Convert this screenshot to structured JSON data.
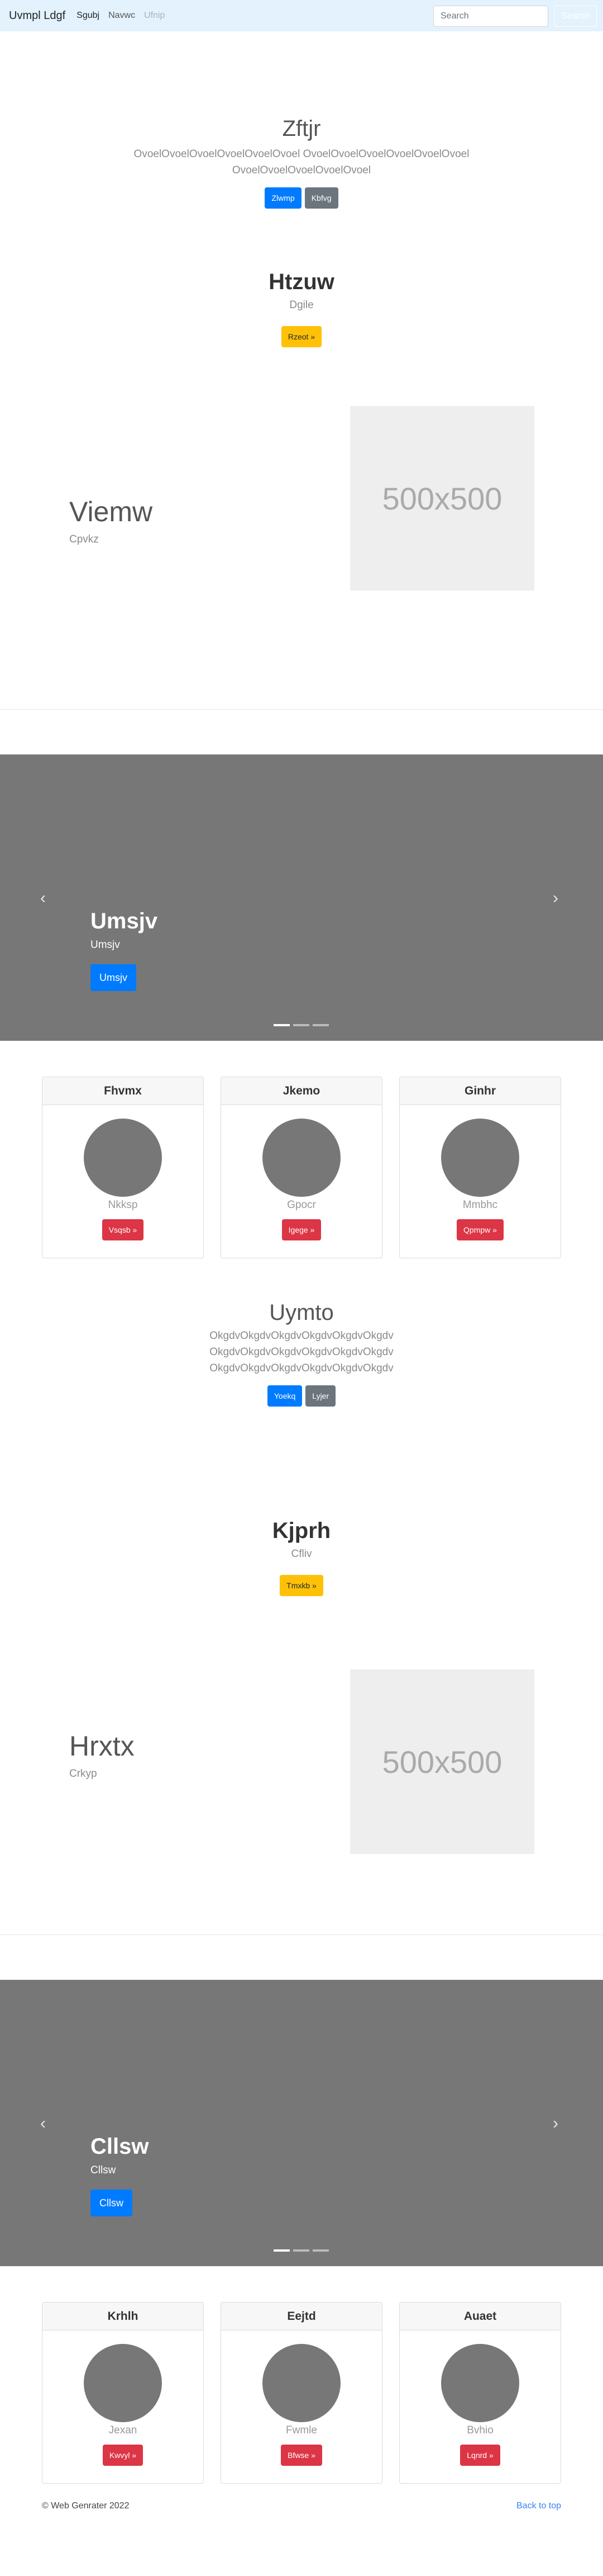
{
  "navbar": {
    "brand": "Uvmpl Ldgf",
    "links": [
      "Sgubj",
      "Navwc",
      "Ufnip"
    ],
    "search_placeholder": "Search",
    "search_button": "Search"
  },
  "block1": {
    "title": "Zftjr",
    "text_line1": "OvoelOvoelOvoelOvoelOvoelOvoel OvoelOvoelOvoelOvoelOvoelOvoel",
    "text_line2": "OvoelOvoelOvoelOvoelOvoel",
    "btn_primary": "Zlwmp",
    "btn_secondary": "Kbfvg"
  },
  "block2": {
    "title": "Htzuw",
    "sub": "Dgile",
    "btn": "Rzeot »"
  },
  "block3": {
    "title": "Viemw",
    "sub": "Cpvkz",
    "image": "500x500"
  },
  "carousel1": {
    "title": "Umsjv",
    "caption": "Umsjv",
    "btn": "Umsjv"
  },
  "cards1": [
    {
      "head": "Fhvmx",
      "name": "Nkksp",
      "btn": "Vsqsb »"
    },
    {
      "head": "Jkemo",
      "name": "Gpocr",
      "btn": "Igege »"
    },
    {
      "head": "Ginhr",
      "name": "Mmbhc",
      "btn": "Qpmpw »"
    }
  ],
  "block4": {
    "title": "Uymto",
    "text_line1": "OkgdvOkgdvOkgdvOkgdvOkgdvOkgdv",
    "text_line2": "OkgdvOkgdvOkgdvOkgdvOkgdvOkgdv",
    "text_line3": "OkgdvOkgdvOkgdvOkgdvOkgdvOkgdv",
    "btn_primary": "Yoekq",
    "btn_secondary": "Lyjer"
  },
  "block5": {
    "title": "Kjprh",
    "sub": "Cfliv",
    "btn": "Tmxkb »"
  },
  "block6": {
    "title": "Hrxtx",
    "sub": "Crkyp",
    "image": "500x500"
  },
  "carousel2": {
    "title": "Cllsw",
    "caption": "Cllsw",
    "btn": "Cllsw"
  },
  "cards2": [
    {
      "head": "Krhlh",
      "name": "Jexan",
      "btn": "Kwvyl »"
    },
    {
      "head": "Eejtd",
      "name": "Fwmle",
      "btn": "Bfwse »"
    },
    {
      "head": "Auaet",
      "name": "Bvhio",
      "btn": "Lqnrd »"
    }
  ],
  "footer": {
    "copyright": "© Web Genrater 2022",
    "back_to_top": "Back to top"
  },
  "icons": {
    "prev": "chevron-left-icon",
    "next": "chevron-right-icon"
  },
  "colors": {
    "navbar_bg": "#e3f2fd",
    "primary": "#007bff",
    "secondary": "#6c757d",
    "warning": "#ffc107",
    "danger": "#dc3545",
    "carousel_bg": "#777777"
  }
}
